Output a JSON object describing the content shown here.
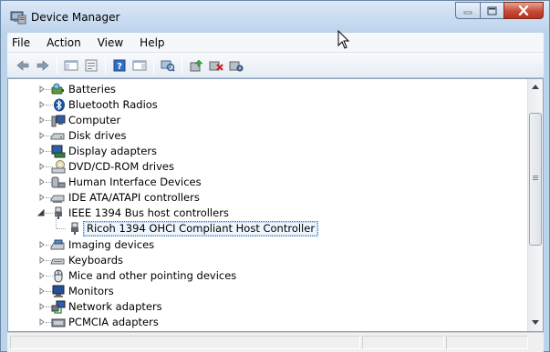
{
  "window": {
    "title": "Device Manager",
    "icon": "device-manager-icon",
    "caption_buttons": [
      "minimize",
      "maximize",
      "close"
    ]
  },
  "menu": {
    "items": [
      "File",
      "Action",
      "View",
      "Help"
    ]
  },
  "toolbar": {
    "buttons": [
      "back-icon",
      "forward-icon",
      "show-hide-console-tree-icon",
      "properties-icon",
      "help-icon",
      "action-pane-icon",
      "scan-hardware-icon",
      "update-driver-icon",
      "disable-device-icon",
      "uninstall-device-icon"
    ]
  },
  "tree": {
    "nodes": [
      {
        "label": "Batteries",
        "icon": "battery-icon",
        "level": 1,
        "expanded": false
      },
      {
        "label": "Bluetooth Radios",
        "icon": "bluetooth-icon",
        "level": 1,
        "expanded": false
      },
      {
        "label": "Computer",
        "icon": "computer-icon",
        "level": 1,
        "expanded": false
      },
      {
        "label": "Disk drives",
        "icon": "disk-drive-icon",
        "level": 1,
        "expanded": false
      },
      {
        "label": "Display adapters",
        "icon": "display-adapter-icon",
        "level": 1,
        "expanded": false
      },
      {
        "label": "DVD/CD-ROM drives",
        "icon": "dvd-drive-icon",
        "level": 1,
        "expanded": false
      },
      {
        "label": "Human Interface Devices",
        "icon": "hid-icon",
        "level": 1,
        "expanded": false
      },
      {
        "label": "IDE ATA/ATAPI controllers",
        "icon": "ide-controller-icon",
        "level": 1,
        "expanded": false
      },
      {
        "label": "IEEE 1394 Bus host controllers",
        "icon": "ieee1394-icon",
        "level": 1,
        "expanded": true
      },
      {
        "label": "Ricoh 1394 OHCI Compliant Host Controller",
        "icon": "ieee1394-icon",
        "level": 2,
        "selected": true
      },
      {
        "label": "Imaging devices",
        "icon": "imaging-device-icon",
        "level": 1,
        "expanded": false
      },
      {
        "label": "Keyboards",
        "icon": "keyboard-icon",
        "level": 1,
        "expanded": false
      },
      {
        "label": "Mice and other pointing devices",
        "icon": "mouse-icon",
        "level": 1,
        "expanded": false
      },
      {
        "label": "Monitors",
        "icon": "monitor-icon",
        "level": 1,
        "expanded": false
      },
      {
        "label": "Network adapters",
        "icon": "network-adapter-icon",
        "level": 1,
        "expanded": false
      },
      {
        "label": "PCMCIA adapters",
        "icon": "pcmcia-icon",
        "level": 1,
        "expanded": false
      }
    ]
  },
  "colors": {
    "title_bar": "#bcd3ec",
    "close_button": "#c74a35",
    "selection_border": "#3a6fb0"
  }
}
